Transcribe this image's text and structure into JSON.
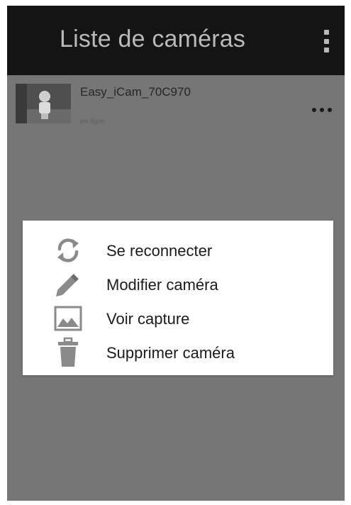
{
  "appbar": {
    "title": "Liste de caméras",
    "overflow_icon": "more-vert-icon"
  },
  "camera_list": {
    "items": [
      {
        "name": "Easy_iCam_70C970",
        "status": "en ligne",
        "thumbnail_icon": "camera-thumbnail",
        "menu_icon": "more-horiz-icon"
      }
    ]
  },
  "context_menu": {
    "items": [
      {
        "label": "Se reconnecter",
        "icon": "refresh-icon"
      },
      {
        "label": "Modifier caméra",
        "icon": "pencil-icon"
      },
      {
        "label": "Voir capture",
        "icon": "image-icon"
      },
      {
        "label": "Supprimer caméra",
        "icon": "trash-icon"
      }
    ]
  },
  "colors": {
    "appbar_background": "#141414",
    "screen_dim_background": "#767676",
    "dialog_background": "#ffffff",
    "icon_gray": "#8a8a8a"
  }
}
